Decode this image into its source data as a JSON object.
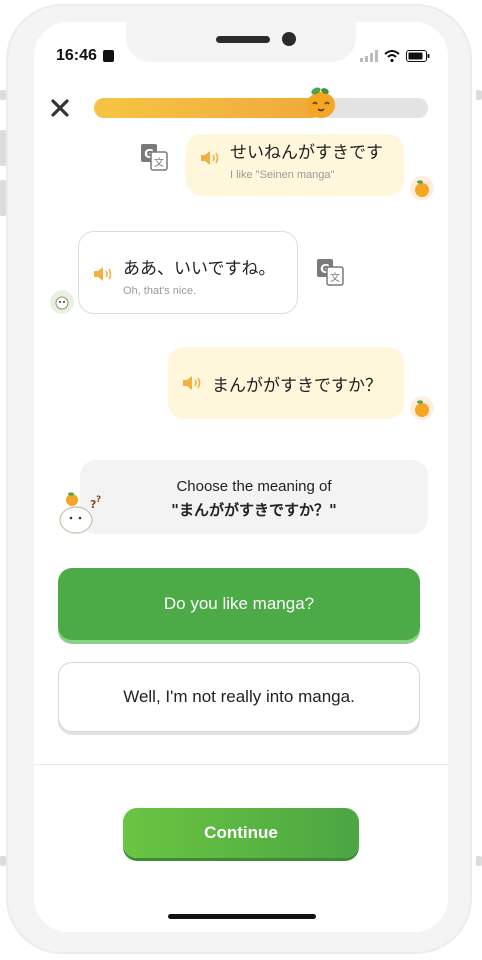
{
  "status_bar": {
    "time": "16:46"
  },
  "lesson": {
    "progress_fraction": 0.68
  },
  "messages": [
    {
      "side": "right",
      "japanese": "せいねんがすきです",
      "translation": "I like \"Seinen manga\""
    },
    {
      "side": "left",
      "japanese": "ああ、いいですね。",
      "translation": "Oh, that's nice."
    },
    {
      "side": "right",
      "japanese": "まんががすきですか？",
      "translation": ""
    }
  ],
  "prompt": {
    "line1": "Choose the meaning of",
    "line2": "\"まんががすきですか？\""
  },
  "options": [
    {
      "label": "Do you like manga?",
      "state": "correct"
    },
    {
      "label": "Well, I'm not really into manga.",
      "state": "default"
    }
  ],
  "continue_button": {
    "label": "Continue"
  },
  "colors": {
    "accent_green": "#4caa47",
    "progress_yellow": "#f6c544",
    "bubble_cream": "#fff7db"
  },
  "icons": [
    "close-icon",
    "speaker-icon",
    "translate-icon",
    "orange-mascot-icon",
    "wifi-icon",
    "battery-icon",
    "signal-icon"
  ]
}
